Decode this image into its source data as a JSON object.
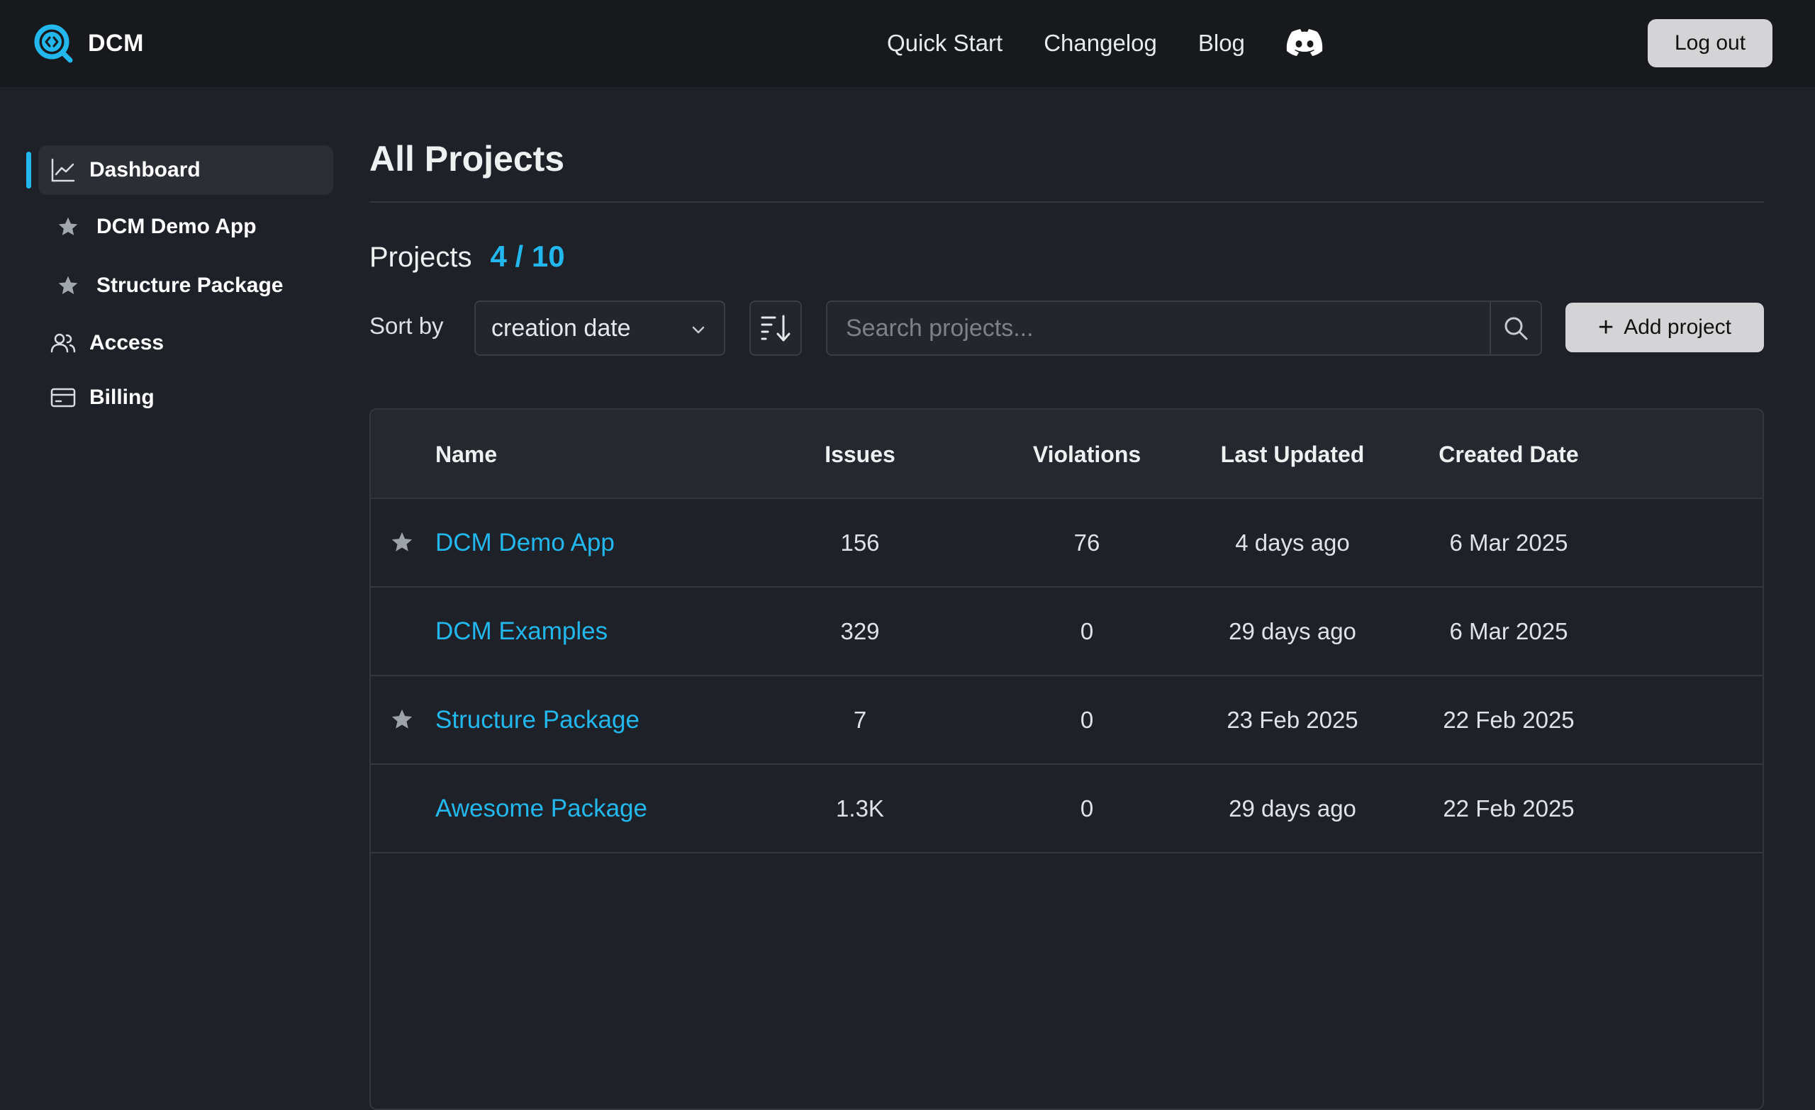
{
  "header": {
    "brand": "DCM",
    "nav": [
      "Quick Start",
      "Changelog",
      "Blog"
    ],
    "logout_label": "Log out"
  },
  "sidebar": {
    "items": [
      {
        "label": "Dashboard",
        "icon": "chart-line-icon",
        "active": true
      },
      {
        "label": "DCM Demo App",
        "icon": "star-icon"
      },
      {
        "label": "Structure Package",
        "icon": "star-icon"
      },
      {
        "label": "Access",
        "icon": "users-icon"
      },
      {
        "label": "Billing",
        "icon": "credit-card-icon"
      }
    ]
  },
  "main": {
    "title": "All Projects",
    "projects_label": "Projects",
    "projects_count": "4 / 10",
    "sort_label": "Sort by",
    "sort_value": "creation date",
    "search_placeholder": "Search projects...",
    "add_label": "Add project"
  },
  "table": {
    "columns": [
      "Name",
      "Issues",
      "Violations",
      "Last Updated",
      "Created Date"
    ],
    "rows": [
      {
        "starred": true,
        "name": "DCM Demo App",
        "issues": "156",
        "violations": "76",
        "updated": "4 days ago",
        "created": "6 Mar 2025"
      },
      {
        "starred": false,
        "name": "DCM Examples",
        "issues": "329",
        "violations": "0",
        "updated": "29 days ago",
        "created": "6 Mar 2025"
      },
      {
        "starred": true,
        "name": "Structure Package",
        "issues": "7",
        "violations": "0",
        "updated": "23 Feb 2025",
        "created": "22 Feb 2025"
      },
      {
        "starred": false,
        "name": "Awesome Package",
        "issues": "1.3K",
        "violations": "0",
        "updated": "29 days ago",
        "created": "22 Feb 2025"
      }
    ]
  },
  "colors": {
    "accent": "#22b8ee",
    "background": "#1e2127",
    "header_bg": "#17191d",
    "button_bg": "#d4d4d6"
  }
}
